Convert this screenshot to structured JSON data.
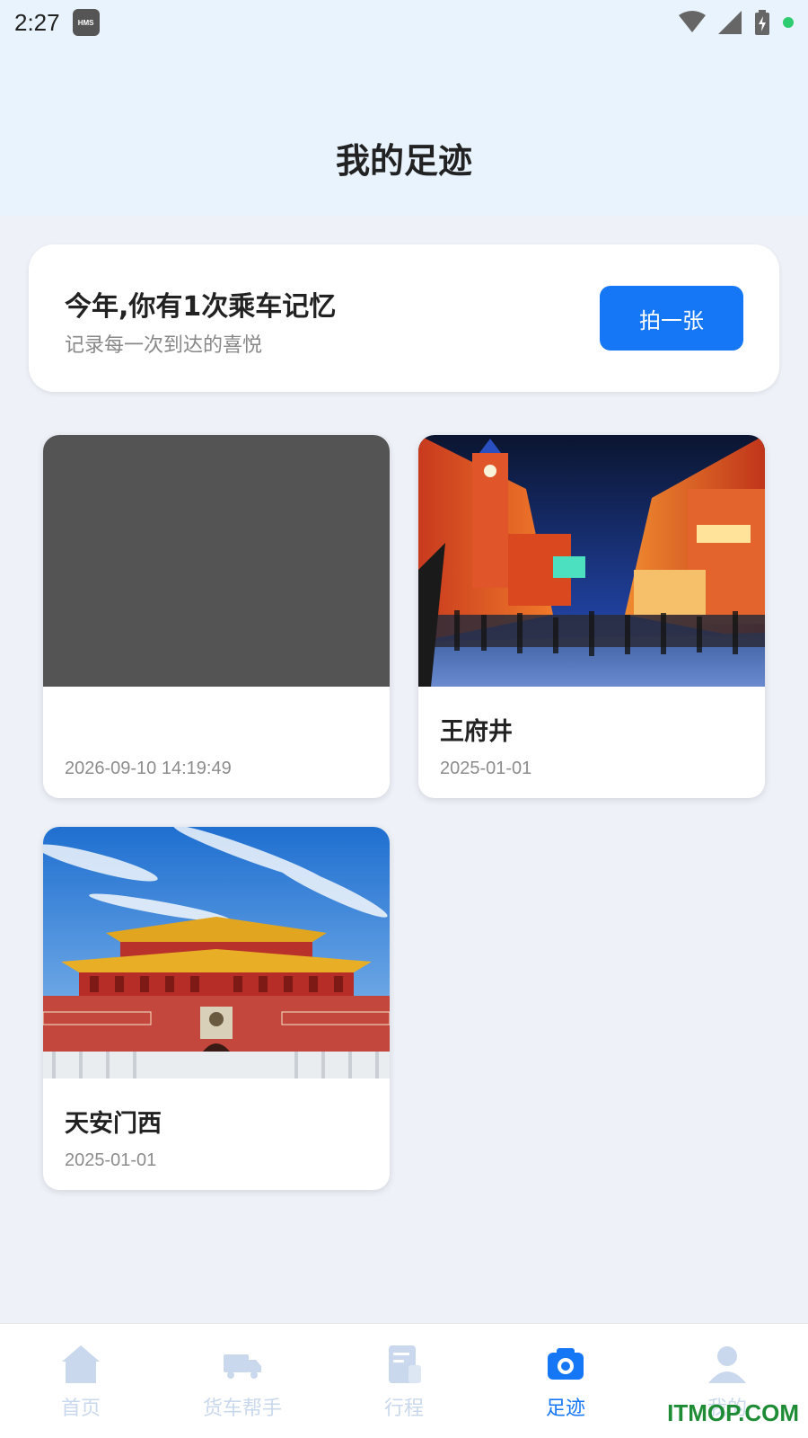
{
  "status_bar": {
    "time": "2:27",
    "hms_badge": "HMS"
  },
  "header": {
    "title": "我的足迹"
  },
  "summary_card": {
    "headline": "今年,你有1次乘车记忆",
    "subtitle": "记录每一次到达的喜悦",
    "button_label": "拍一张"
  },
  "footprints": [
    {
      "name": "",
      "date": "2026-09-10 14:19:49",
      "image": "placeholder-gray"
    },
    {
      "name": "王府井",
      "date": "2025-01-01",
      "image": "wangfujing-night-street"
    },
    {
      "name": "天安门西",
      "date": "2025-01-01",
      "image": "tiananmen-gate"
    }
  ],
  "tab_bar": {
    "items": [
      {
        "label": "首页",
        "icon": "home-icon",
        "active": false
      },
      {
        "label": "货车帮手",
        "icon": "truck-icon",
        "active": false
      },
      {
        "label": "行程",
        "icon": "trip-icon",
        "active": false
      },
      {
        "label": "足迹",
        "icon": "camera-icon",
        "active": true
      },
      {
        "label": "我的",
        "icon": "user-icon",
        "active": false
      }
    ]
  },
  "watermark": "ITMOP.COM",
  "colors": {
    "accent": "#1677f6",
    "header_bg": "#e8f3fd",
    "page_bg": "#eef2f8",
    "tab_inactive": "#c9d8ec"
  }
}
